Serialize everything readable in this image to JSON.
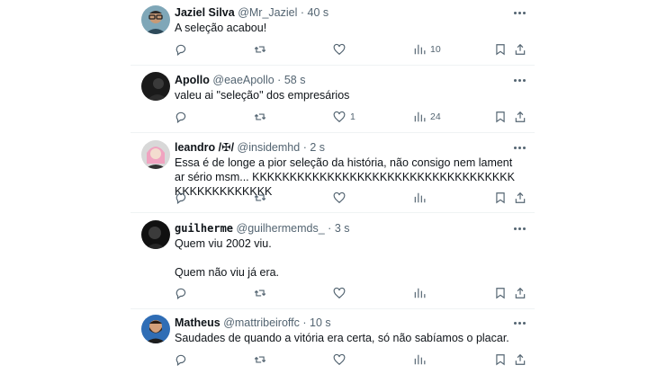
{
  "tweets": [
    {
      "name": "Jaziel Silva",
      "handle": "@Mr_Jaziel",
      "sep": "·",
      "time": "40 s",
      "text": "A seleção acabou!",
      "reply_count": "",
      "retweet_count": "",
      "like_count": "",
      "view_count": "10",
      "avatar": "avatar-man-glasses"
    },
    {
      "name": "Apollo",
      "handle": "@eaeApollo",
      "sep": "·",
      "time": "58 s",
      "text": "valeu ai \"seleção\" dos empresários",
      "reply_count": "",
      "retweet_count": "",
      "like_count": "1",
      "view_count": "24",
      "avatar": "avatar-dark"
    },
    {
      "name": "leandro /✠/",
      "handle": "@insidemhd",
      "sep": "·",
      "time": "2 s",
      "text": "Essa é de longe a pior seleção da história, não consigo nem lamentar sério msm... KKKKKKKKKKKKKKKKKKKKKKKKKKKKKKKKKKKKKKKKKKKKKKKK",
      "reply_count": "",
      "retweet_count": "",
      "like_count": "",
      "view_count": "",
      "avatar": "avatar-pink-hair"
    },
    {
      "name": "guilherme",
      "handle": "@guilhermemds_",
      "sep": "·",
      "time": "3 s",
      "text": "Quem viu 2002 viu.\n\nQuem não viu já era.",
      "reply_count": "",
      "retweet_count": "",
      "like_count": "",
      "view_count": "",
      "avatar": "avatar-dark-photo"
    },
    {
      "name": "Matheus",
      "handle": "@mattribeiroffc",
      "sep": "·",
      "time": "10 s",
      "text": "Saudades de quando a vitória era certa, só não sabíamos o placar.",
      "reply_count": "",
      "retweet_count": "",
      "like_count": "",
      "view_count": "",
      "avatar": "avatar-bearded-man"
    }
  ],
  "colors": {
    "text": "#0f1419",
    "muted": "#536471",
    "divider": "#eff3f4"
  },
  "icons": [
    "reply-icon",
    "retweet-icon",
    "like-icon",
    "views-icon",
    "bookmark-icon",
    "share-icon",
    "more-icon"
  ]
}
